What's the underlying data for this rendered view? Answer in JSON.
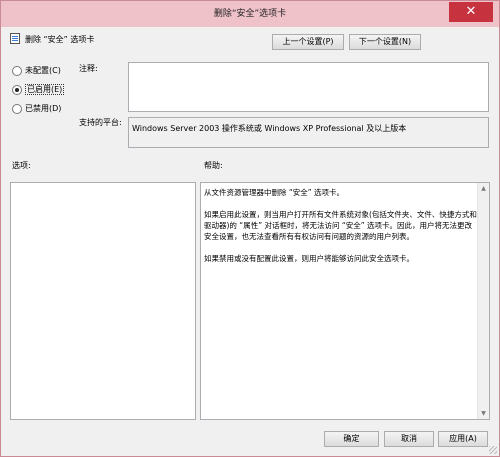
{
  "window": {
    "title": "删除“安全”选项卡",
    "close_glyph": "✕"
  },
  "header": {
    "policy_name": "删除 “安全” 选项卡",
    "prev_button": "上一个设置(P)",
    "next_button": "下一个设置(N)"
  },
  "state_options": [
    {
      "label": "未配置(C)",
      "checked": false
    },
    {
      "label": "已启用(E)",
      "checked": true
    },
    {
      "label": "已禁用(D)",
      "checked": false
    }
  ],
  "comment": {
    "label": "注释:",
    "value": ""
  },
  "platform": {
    "label": "支持的平台:",
    "value": "Windows Server 2003 操作系统或 Windows XP Professional 及以上版本"
  },
  "options": {
    "label": "选项:"
  },
  "help": {
    "label": "帮助:",
    "paragraphs": [
      "从文件资源管理器中删除 “安全” 选项卡。",
      "如果启用此设置，则当用户打开所有文件系统对象(包括文件夹、文件、快捷方式和驱动器)的 “属性” 对话框时，将无法访问 “安全” 选项卡。因此，用户将无法更改安全设置，也无法查看所有有权访问有问题的资源的用户列表。",
      "如果禁用或没有配置此设置，则用户将能够访问此安全选项卡。"
    ]
  },
  "footer": {
    "ok_button": "确定",
    "cancel_button": "取消",
    "apply_button": "应用(A)"
  },
  "scrollbar": {
    "up_glyph": "▲",
    "down_glyph": "▼"
  }
}
